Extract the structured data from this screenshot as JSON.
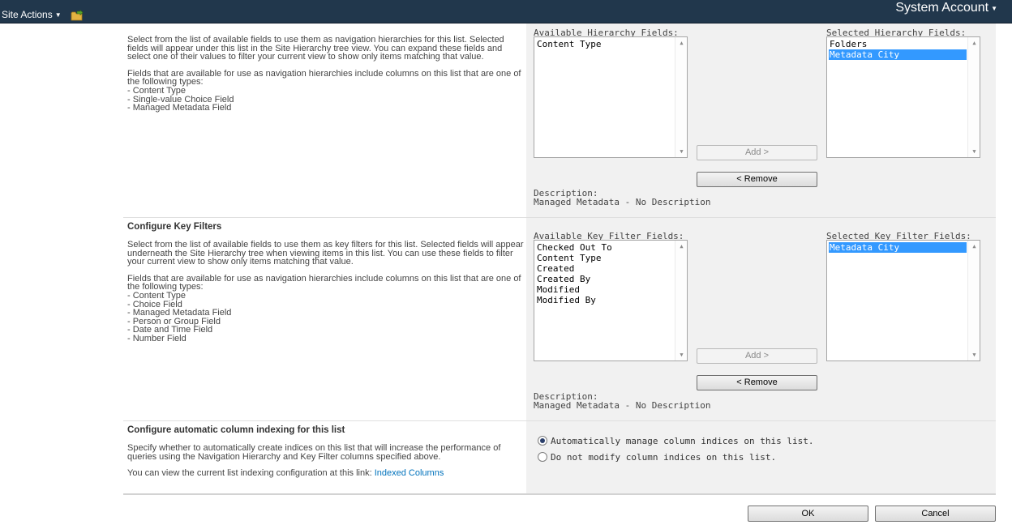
{
  "topbar": {
    "site_actions": "Site Actions",
    "user": "System Account"
  },
  "hierarchy": {
    "desc1": "Select from the list of available fields to use them as navigation hierarchies for this list.  Selected fields will appear under this list in the Site Hierarchy tree view.  You can expand these fields and select one of their values to filter your current view to show only items matching that value.",
    "desc2": "Fields that are available for use as navigation hierarchies include columns on this list that are one of the following types:\n- Content Type\n- Single-value Choice Field\n- Managed Metadata Field",
    "available_label": "Available Hierarchy Fields:",
    "available_items": [
      "Content Type"
    ],
    "selected_label": "Selected Hierarchy Fields:",
    "selected_items": [
      "Folders",
      "Metadata City"
    ],
    "add_label": "Add >",
    "remove_label": "< Remove",
    "description_label": "Description:",
    "description_value": "Managed Metadata - No Description"
  },
  "key_filters": {
    "title": "Configure Key Filters",
    "desc1": "Select from the list of available fields to use them as key filters for this list.  Selected fields will appear underneath the Site Hierarchy tree when viewing items in this list.  You can use these fields to filter your current view to show only items matching that value.",
    "desc2": "Fields that are available for use as navigation hierarchies include columns on this list that are one of the following types:\n- Content Type\n- Choice Field\n- Managed Metadata Field\n- Person or Group Field\n- Date and Time Field\n- Number Field",
    "available_label": "Available Key Filter Fields:",
    "available_items": [
      "Checked Out To",
      "Content Type",
      "Created",
      "Created By",
      "Modified",
      "Modified By"
    ],
    "selected_label": "Selected Key Filter Fields:",
    "selected_items": [
      "Metadata City"
    ],
    "add_label": "Add >",
    "remove_label": "< Remove",
    "description_label": "Description:",
    "description_value": "Managed Metadata - No Description"
  },
  "indexing": {
    "title": "Configure automatic column indexing for this list",
    "desc1": "Specify whether to automatically create indices on this list that will increase the performance of queries using the Navigation Hierarchy and Key Filter columns specified above.",
    "desc2_prefix": "You can view the current list indexing configuration at this link: ",
    "link": "Indexed Columns",
    "option_auto": "Automatically manage column indices on this list.",
    "option_none": "Do not modify column indices on this list.",
    "selected_option": "auto"
  },
  "footer": {
    "ok": "OK",
    "cancel": "Cancel"
  },
  "colors": {
    "topbar_bg": "#21374c",
    "selection": "#3399ff",
    "link": "#0072bc",
    "panel_bg": "#f1f1f1"
  }
}
